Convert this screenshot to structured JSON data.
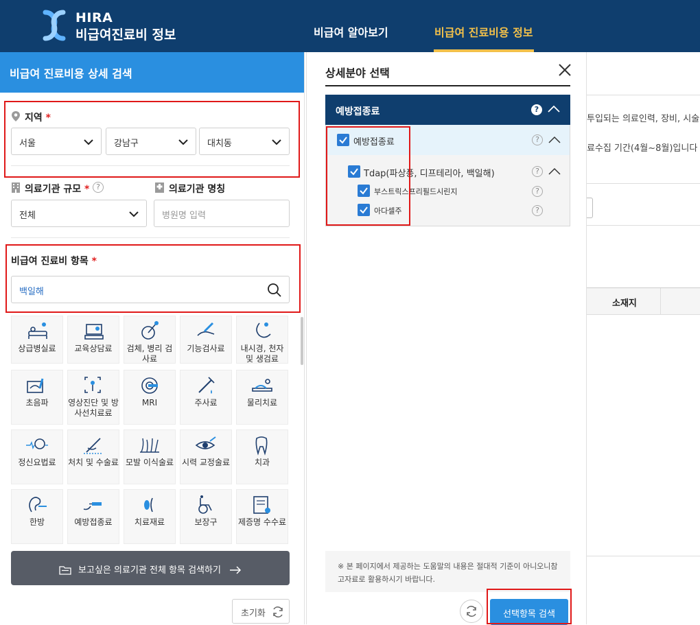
{
  "header": {
    "logo_line1": "HIRA",
    "logo_line2": "비급여진료비 정보",
    "nav": [
      "비급여 알아보기",
      "비급여 진료비용 정보"
    ],
    "active_color": "#f2c04a",
    "bg_color": "#0f3e6e"
  },
  "left_panel": {
    "title": "비급여 진료비용 상세 검색",
    "region": {
      "label": "지역",
      "required": "*",
      "selects": [
        "서울",
        "강남구",
        "대치동"
      ]
    },
    "scale": {
      "label": "의료기관 규모",
      "required": "*",
      "help": "?",
      "value": "전체"
    },
    "name": {
      "label": "의료기관 명칭",
      "placeholder": "병원명 입력"
    },
    "item": {
      "label": "비급여 진료비 항목",
      "required": "*",
      "value": "백일해"
    },
    "categories": [
      {
        "label": "상급병실료",
        "icon": "hospital-bed-icon"
      },
      {
        "label": "교육상담료",
        "icon": "counseling-icon"
      },
      {
        "label": "검체, 병리 검사료",
        "icon": "specimen-test-icon"
      },
      {
        "label": "기능검사료",
        "icon": "function-test-icon"
      },
      {
        "label": "내시경, 천자 및 생검료",
        "icon": "endoscope-icon"
      },
      {
        "label": "초음파",
        "icon": "ultrasound-icon"
      },
      {
        "label": "영상진단 및 방사선치료료",
        "icon": "radiology-icon"
      },
      {
        "label": "MRI",
        "icon": "mri-icon"
      },
      {
        "label": "주사료",
        "icon": "injection-icon"
      },
      {
        "label": "물리치료",
        "icon": "physical-therapy-icon"
      },
      {
        "label": "정신요법료",
        "icon": "psychotherapy-icon"
      },
      {
        "label": "처치 및 수술료",
        "icon": "surgery-icon"
      },
      {
        "label": "모발 이식술료",
        "icon": "hair-transplant-icon"
      },
      {
        "label": "시력 교정술료",
        "icon": "eye-icon"
      },
      {
        "label": "치과",
        "icon": "tooth-icon"
      },
      {
        "label": "한방",
        "icon": "acupuncture-icon"
      },
      {
        "label": "예방접종료",
        "icon": "vaccination-icon"
      },
      {
        "label": "치료재료",
        "icon": "treatment-material-icon"
      },
      {
        "label": "보장구",
        "icon": "wheelchair-icon"
      },
      {
        "label": "제증명 수수료",
        "icon": "certificate-icon"
      }
    ],
    "all_search_button": "보고싶은 의료기관 전체 항목 검색하기",
    "reset_button": "초기화"
  },
  "modal": {
    "title": "상세분야 선택",
    "category_header": "예방접종료",
    "tree": {
      "level1": "예방접종료",
      "level2": "Tdap(파상풍, 디프테리아, 백일해)",
      "level3": [
        "부스트릭스프리필드시린지",
        "아다셀주"
      ]
    },
    "notice": "※ 본 페이지에서 제공하는 도움말의 내용은 절대적 기준이 아니오니참고자료로 활용하시기 바랍니다.",
    "search_button": "선택항목 검색",
    "accent_color": "#2a8fe0",
    "check_color": "#2a7bd4"
  },
  "background": {
    "text1": "투입되는 의료인력, 장비, 시술",
    "text2": "료수집 기간(4월~8월)입니다",
    "column_header": "소재지"
  }
}
